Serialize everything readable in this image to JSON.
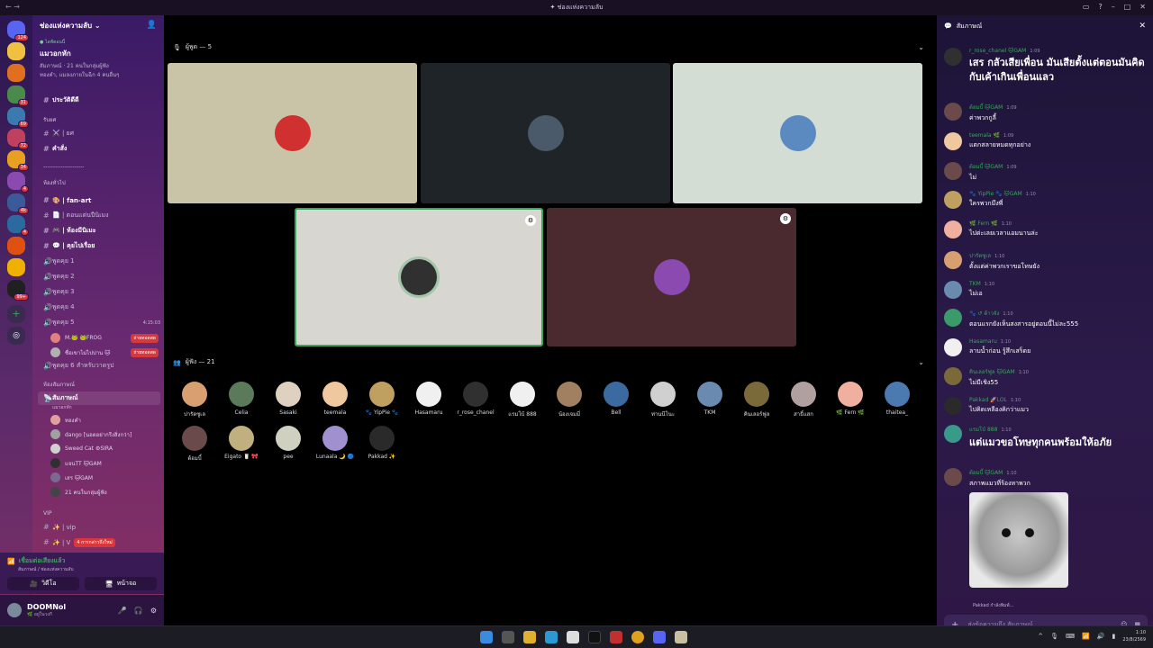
{
  "window": {
    "title": "✦ ช่องแห่งความลับ",
    "nav_back": "←",
    "nav_fwd": "→"
  },
  "guilds": [
    {
      "color": "#5865f2",
      "badge": "124"
    },
    {
      "color": "#f0c040",
      "badge": ""
    },
    {
      "color": "#e07020",
      "badge": ""
    },
    {
      "color": "#4a8a4a",
      "badge": "31"
    },
    {
      "color": "#3a7ab0",
      "badge": "69"
    },
    {
      "color": "#c04060",
      "badge": "72"
    },
    {
      "color": "#e8a020",
      "badge": "34"
    },
    {
      "color": "#8a4ab0",
      "badge": "4"
    },
    {
      "color": "#3a5a9a",
      "badge": "4k"
    },
    {
      "color": "#2a6aa0",
      "badge": "4"
    },
    {
      "color": "#e05010",
      "badge": ""
    },
    {
      "color": "#f0b000",
      "badge": ""
    },
    {
      "color": "#202020",
      "badge": "99+"
    }
  ],
  "sidebar": {
    "server_name": "ช่องแห่งความลับ ⌄",
    "event": {
      "tag": "● ไลฟ์ตอนนี้",
      "title": "แมวอกหัก",
      "line1": "สัมภาษณ์ · 21 คนในกลุ่มผู้ฟัง",
      "line2": "ทองคำ, แมลงภายในฉีก 4 คนอื่นๆ"
    },
    "channels": [
      {
        "label": "ประวัติดีดี",
        "type": "text",
        "bold": true
      },
      {
        "label": "รับยศ",
        "type": "cat"
      },
      {
        "label": "⚔️ | ยศ",
        "type": "text"
      },
      {
        "label": "คำสั่ง",
        "type": "text",
        "bold": true
      },
      {
        "label": "---------------------",
        "type": "cat"
      },
      {
        "label": "ห้องทั่วไป",
        "type": "cat"
      },
      {
        "label": "🎨 | fan-art",
        "type": "text",
        "bold": true
      },
      {
        "label": "📄 | ตอนแต่นปีนิเมง",
        "type": "text"
      },
      {
        "label": "🎮 | ห้องมีนิเมะ",
        "type": "text",
        "bold": true
      },
      {
        "label": "💬 | คุยไปเรื่อย",
        "type": "text",
        "bold": true
      },
      {
        "label": "พูดคุย 1",
        "type": "voice"
      },
      {
        "label": "พูดคุย 2",
        "type": "voice"
      },
      {
        "label": "พูดคุย 3",
        "type": "voice"
      },
      {
        "label": "พูดคุย 4",
        "type": "voice"
      },
      {
        "label": "พูดคุย 5",
        "type": "voice",
        "timer": "4:15:03"
      }
    ],
    "voice5_users": [
      {
        "name": "M.🐸 🐸FROG",
        "live": "ถ่ายทอดสด",
        "color": "#e08080"
      },
      {
        "name": "ชื่อเขาไม่ไปบ่าน 🐱",
        "live": "ถ่ายทอดสด",
        "color": "#b0b0b0"
      }
    ],
    "voice6": "พูดคุย 6 สำหรับวาดรูป",
    "stage_cat": "ห้องสัมภาษณ์",
    "stage": {
      "label": "สัมภาษณ์",
      "sub": "แมวอกหัก"
    },
    "stage_users": [
      {
        "name": "ทองคำ",
        "color": "#e0a0a0"
      },
      {
        "name": "dango [นอตอย่ากรีงสิ่งกว่า]",
        "color": "#a0a0a0"
      },
      {
        "name": "Sweed Cat ⚙SIRA",
        "color": "#d0d0d0"
      },
      {
        "name": "แจนTT 🐱GAM",
        "color": "#303030"
      },
      {
        "name": "เสร 🐱GAM",
        "color": "#7a6a90"
      },
      {
        "name": "21 คนในกลุ่มผู้ฟัง",
        "color": "#444"
      }
    ],
    "vip_cat": "VIP",
    "vip_channels": [
      {
        "label": "✨ | vip"
      },
      {
        "label": "✨ | V"
      }
    ],
    "new_mentions": "4 การกล่าวถึงใหม่"
  },
  "voice_panel": {
    "status": "เชื่อมต่อเสียงแล้ว",
    "sub": "สัมภาษณ์ / ช่องแห่งความลับ",
    "video": "วิดีโอ",
    "screen": "หน้าจอ"
  },
  "user_panel": {
    "name": "DOOMNol",
    "status": "🌿 อยู่ในวงกี"
  },
  "main": {
    "speakers_header": "ผู้พูด — 5",
    "audience_header": "ผู้ฟัง — 21",
    "speakers": [
      {
        "bg": "#c9c4a8",
        "av": "#d03030"
      },
      {
        "bg": "#1e2427",
        "av": "#4a5a6a"
      },
      {
        "bg": "#d4ddd4",
        "av": "#5a8ac0"
      },
      {
        "bg": "#d8d6d0",
        "av": "#303030"
      },
      {
        "bg": "#4a2a2e",
        "av": "#8a4ab0"
      }
    ],
    "audience": [
      {
        "name": "ปารัดซูเล",
        "color": "#d8a070"
      },
      {
        "name": "Celia",
        "color": "#5a7a5a"
      },
      {
        "name": "Sasaki",
        "color": "#e0d0c0"
      },
      {
        "name": "teemala",
        "color": "#f0c8a0"
      },
      {
        "name": "🐾 YipPie 🐾",
        "color": "#c0a060"
      },
      {
        "name": "Hasamaru",
        "color": "#f0f0f0"
      },
      {
        "name": "r_rose_chanel",
        "color": "#303030"
      },
      {
        "name": "แรมโบ้ 888",
        "color": "#f0f0f0"
      },
      {
        "name": "น้องเจมมี่",
        "color": "#a08060"
      },
      {
        "name": "Bell",
        "color": "#3a6aa0"
      },
      {
        "name": "ท่านนีโนะ",
        "color": "#d0d0d0"
      },
      {
        "name": "TKM",
        "color": "#6a8ab0"
      },
      {
        "name": "คินเลอร์ฟูล",
        "color": "#7a6a3a"
      },
      {
        "name": "สาธิ์แสก",
        "color": "#b0a0a0"
      },
      {
        "name": "🌿 Fern 🌿",
        "color": "#f0b0a0"
      },
      {
        "name": "thaitea_",
        "color": "#4a7ab0"
      },
      {
        "name": "ต้อมบี้",
        "color": "#6a4a4a"
      },
      {
        "name": "Eigato 🥛 🎀",
        "color": "#c0b080"
      },
      {
        "name": "pee",
        "color": "#d0d0c0"
      },
      {
        "name": "Lunaala 🌙 🔵",
        "color": "#a090d0"
      },
      {
        "name": "Pakkad ✨",
        "color": "#2a2a2a"
      }
    ]
  },
  "chat": {
    "title": "สัมภาษณ์",
    "messages": [
      {
        "name": "r_rose_chanel 🐱GAM",
        "time": "1:09",
        "text": "เสร กลัวเสียเพื่อน มันเสียตั้งแต่ตอนมันคิดกับเค้าเกินเพื่อนแลว",
        "big": true,
        "color": "#303030"
      },
      {
        "name": "ต้อมบี้ 🐱GAM",
        "time": "1:09",
        "text": "ค่าพวกกูลี้",
        "color": "#6a4a4a"
      },
      {
        "name": "teemala 🌿",
        "time": "1:09",
        "text": "แตกสลายหมดทุกอย่าง",
        "color": "#f0c8a0"
      },
      {
        "name": "ต้อมบี้ 🐱GAM",
        "time": "1:09",
        "text": "ไม่",
        "color": "#6a4a4a"
      },
      {
        "name": "🐾 YipPie 🐾 🐱GAM",
        "time": "1:10",
        "text": "ใครพวกมึงพี่",
        "color": "#c0a060"
      },
      {
        "name": "🌿 Fern 🌿",
        "time": "1:10",
        "text": "ไปด่ะเลยเวลาแอมนานล่ะ",
        "color": "#f0b0a0"
      },
      {
        "name": "ปารัดซูเล",
        "time": "1:10",
        "text": "ตั้งแต่ค่าพวกเราขอโทษยัง",
        "color": "#d8a070"
      },
      {
        "name": "TKM",
        "time": "1:10",
        "text": "ไม่เอ",
        "color": "#6a8ab0"
      },
      {
        "name": "🐾 ↺ ต้าวจัง",
        "time": "1:10",
        "text": "ตอนแรกยังเห็นสงสารอยู่ตอนนี้ไม่ละ555",
        "color": "#3a9a6a"
      },
      {
        "name": "Hasamaru",
        "time": "1:10",
        "text": "ลาบน้ำก่อน รู้สึกเสร็ดย",
        "color": "#f0f0f0"
      },
      {
        "name": "คินเลอร์ฟูล 🐱GAM",
        "time": "1:10",
        "text": "ไม่มีเชิง55",
        "color": "#7a6a3a"
      },
      {
        "name": "Pakkad 🚀LOL",
        "time": "1:10",
        "text": "ไปคิดเหลืองคิกว่าแมว",
        "color": "#2a2a2a"
      },
      {
        "name": "แรมโบ้ 888",
        "time": "1:10",
        "text": "แต่แมวขอโทษทุกคนพร้อมให้อภัย",
        "big": true,
        "color": "#3a9a8a"
      },
      {
        "name": "ต้อมบี้ 🐱GAM",
        "time": "1:10",
        "text": "สภาพแมวที่ร้องหาพวก",
        "color": "#6a4a4a"
      }
    ],
    "typing": "Pakkad กำลังพิมพ์...",
    "input_placeholder": "ส่งข้อความถึง สัมภาษณ์"
  },
  "taskbar": {
    "time": "1:10",
    "date": "23/8/2569"
  }
}
